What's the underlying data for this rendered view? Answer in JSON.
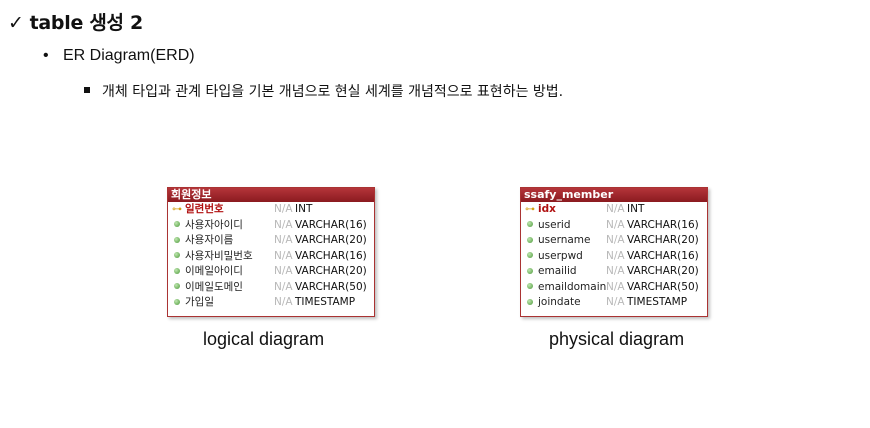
{
  "heading": {
    "check": "✓",
    "title": "table 생성 2"
  },
  "bullet_level1": {
    "dot": "•",
    "text": "ER Diagram(ERD)"
  },
  "bullet_level2": {
    "text": "개체 타입과 관계 타입을 기본 개념으로 현실 세계를 개념적으로 표현하는 방법."
  },
  "logical": {
    "table_name": "회원정보",
    "caption": "logical diagram",
    "rows": [
      {
        "icon": "key-icon",
        "name": "일련번호",
        "nullable": "N/A",
        "type": "INT",
        "pk": true
      },
      {
        "icon": "column-icon",
        "name": "사용자아이디",
        "nullable": "N/A",
        "type": "VARCHAR(16)",
        "pk": false
      },
      {
        "icon": "column-icon",
        "name": "사용자이름",
        "nullable": "N/A",
        "type": "VARCHAR(20)",
        "pk": false
      },
      {
        "icon": "column-icon",
        "name": "사용자비밀번호",
        "nullable": "N/A",
        "type": "VARCHAR(16)",
        "pk": false
      },
      {
        "icon": "column-icon",
        "name": "이메일아이디",
        "nullable": "N/A",
        "type": "VARCHAR(20)",
        "pk": false
      },
      {
        "icon": "column-icon",
        "name": "이메일도메인",
        "nullable": "N/A",
        "type": "VARCHAR(50)",
        "pk": false
      },
      {
        "icon": "column-icon",
        "name": "가입일",
        "nullable": "N/A",
        "type": "TIMESTAMP",
        "pk": false
      }
    ]
  },
  "physical": {
    "table_name": "ssafy_member",
    "caption": "physical diagram",
    "rows": [
      {
        "icon": "key-icon",
        "name": "idx",
        "nullable": "N/A",
        "type": "INT",
        "pk": true
      },
      {
        "icon": "column-icon",
        "name": "userid",
        "nullable": "N/A",
        "type": "VARCHAR(16)",
        "pk": false
      },
      {
        "icon": "column-icon",
        "name": "username",
        "nullable": "N/A",
        "type": "VARCHAR(20)",
        "pk": false
      },
      {
        "icon": "column-icon",
        "name": "userpwd",
        "nullable": "N/A",
        "type": "VARCHAR(16)",
        "pk": false
      },
      {
        "icon": "column-icon",
        "name": "emailid",
        "nullable": "N/A",
        "type": "VARCHAR(20)",
        "pk": false
      },
      {
        "icon": "column-icon",
        "name": "emaildomain",
        "nullable": "N/A",
        "type": "VARCHAR(50)",
        "pk": false
      },
      {
        "icon": "column-icon",
        "name": "joindate",
        "nullable": "N/A",
        "type": "TIMESTAMP",
        "pk": false
      }
    ]
  },
  "colors": {
    "header_red": "#b4353a",
    "pk_red": "#b01010",
    "key_gold": "#d4a017",
    "column_green": "#4c9a3a",
    "nullable_gray": "#b8b8b8"
  }
}
